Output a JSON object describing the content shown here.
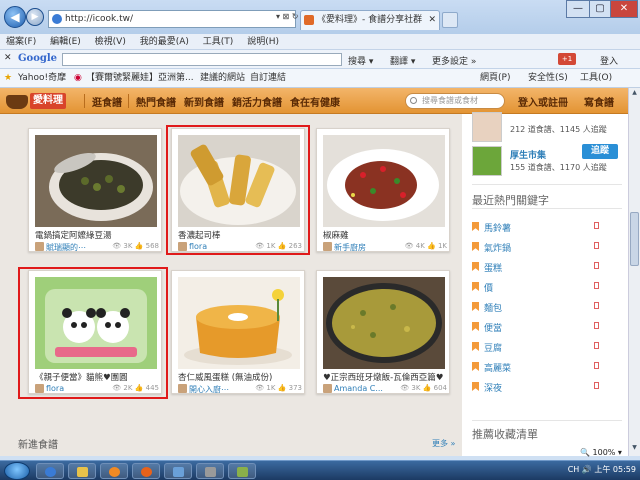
{
  "browser": {
    "url": "http://icook.tw/",
    "addr_btns": "▾ ⊠ ↻ ✕",
    "tab_title": "《愛料理》- 食譜分享社群",
    "tab_close": "✕",
    "win_min": "—",
    "win_max": "▢",
    "win_close": "✕",
    "back": "◀",
    "fwd": "▶",
    "zoom": "100%"
  },
  "menubar": [
    "檔案(F)",
    "編輯(E)",
    "檢視(V)",
    "我的最愛(A)",
    "工具(T)",
    "說明(H)"
  ],
  "google_bar": {
    "logo": "Google",
    "search_label": "搜尋",
    "translate_label": "翻譯",
    "more_label": "更多設定 »",
    "gplus": "+1",
    "login": "登入"
  },
  "favorites": {
    "items": [
      "Yahoo!奇摩",
      "【賽爾號緊麗娃】亞洲第...",
      "建議的網站",
      "自訂連結"
    ],
    "tools": [
      "網頁(P)",
      "安全性(S)",
      "工具(O)"
    ]
  },
  "site": {
    "logo_text": "愛料理",
    "nav": [
      "逛食譜",
      "熱門食譜",
      "新到食譜",
      "銷活力食譜",
      "食在有健康"
    ],
    "search_placeholder": "搜尋食譜或食材",
    "login": "登入或註冊",
    "post": "寫食譜"
  },
  "cards": [
    {
      "title": "電鍋搞定阿嬤綠豆湯",
      "author": "賦瑞顯的⋯",
      "views": "3K",
      "likes": "568"
    },
    {
      "title": "香濃起司棒",
      "author": "flora",
      "views": "1K",
      "likes": "263"
    },
    {
      "title": "椒麻雞",
      "author": "新手廚房",
      "views": "4K",
      "likes": "1K"
    },
    {
      "title": "《親子便當》貓熊♥團圓",
      "author": "flora",
      "views": "2K",
      "likes": "445"
    },
    {
      "title": "杏仁威風蛋糕 (無油成份)",
      "author": "開心入廚⋯",
      "views": "1K",
      "likes": "373"
    },
    {
      "title": "♥正宗西班牙燉飯-瓦倫西亞篇♥",
      "author": "Amanda C...",
      "views": "3K",
      "likes": "604"
    }
  ],
  "latest_section": "新進食譜",
  "more_link": "更多 »",
  "sidebar": {
    "profiles": [
      {
        "name": "",
        "stats": "212 道食譜、1145 人追蹤"
      },
      {
        "name": "厚生市集",
        "stats": "155 道食譜、1170 人追蹤",
        "follow": "追蹤"
      }
    ],
    "hot_title": "最近熱門關鍵字",
    "keywords": [
      "馬鈴薯",
      "氣炸鍋",
      "蛋糕",
      "價",
      "麵包",
      "便當",
      "豆腐",
      "高麗菜",
      "深夜"
    ],
    "collect_title": "推薦收藏清單"
  },
  "taskbar": {
    "time": "上午 05:59",
    "lang": "CH"
  },
  "colors": {
    "nav_orange": "#e39433",
    "highlight_red": "#e01a1a",
    "link_blue": "#2f7fb8"
  }
}
